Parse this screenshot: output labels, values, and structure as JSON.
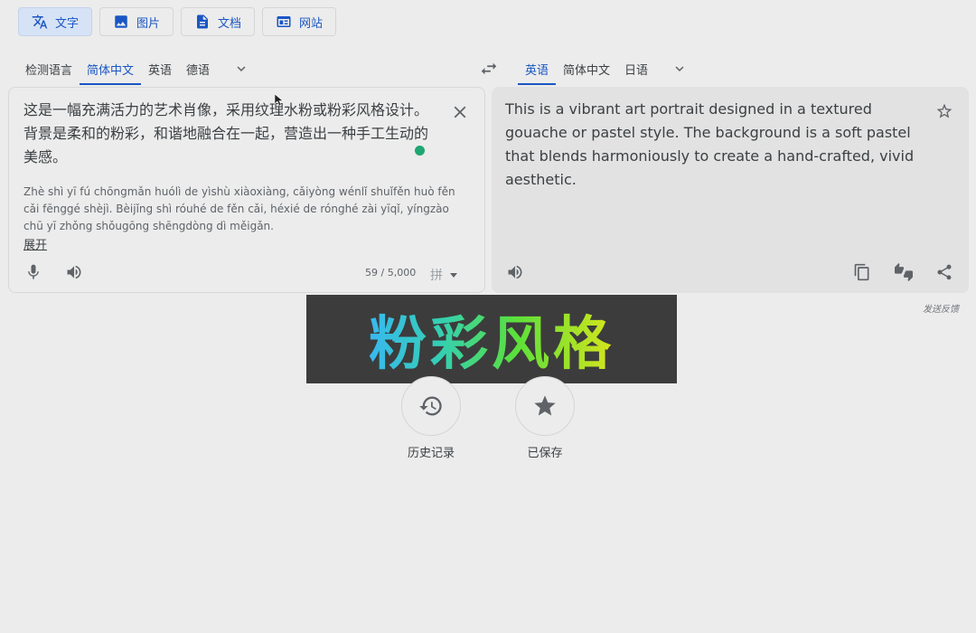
{
  "modes": [
    {
      "label": "文字",
      "icon": "translate-icon",
      "active": true
    },
    {
      "label": "图片",
      "icon": "image-icon",
      "active": false
    },
    {
      "label": "文档",
      "icon": "document-icon",
      "active": false
    },
    {
      "label": "网站",
      "icon": "website-icon",
      "active": false
    }
  ],
  "source_langs": [
    "检测语言",
    "简体中文",
    "英语",
    "德语"
  ],
  "source_active": "简体中文",
  "target_langs": [
    "英语",
    "简体中文",
    "日语"
  ],
  "target_active": "英语",
  "source": {
    "text": "这是一幅充满活力的艺术肖像，采用纹理水粉或粉彩风格设计。背景是柔和的粉彩，和谐地融合在一起，营造出一种手工生动的美感。",
    "pinyin": "Zhè shì yī fú chōngmǎn huólì de yìshù xiàoxiàng, cǎiyòng wénlǐ shuǐfěn huò fěn cǎi fēnggé shèjì. Bèijǐng shì róuhé de fěn cǎi, héxié de rónghé zài yīqǐ, yíngzào chū yī zhǒng shǒugōng shēngdòng dì měigǎn.",
    "expand_label": "展开",
    "char_count": "59 / 5,000",
    "ime_label": "拼"
  },
  "target": {
    "text": "This is a vibrant art portrait designed in a textured gouache or pastel style. The background is a soft pastel that blends harmoniously to create a hand-crafted, vivid aesthetic."
  },
  "feedback_label": "发送反馈",
  "overlay_text": "粉彩风格",
  "history_label": "历史记录",
  "saved_label": "已保存",
  "colors": {
    "accent": "#1a56c4",
    "status_dot": "#1fa672"
  }
}
